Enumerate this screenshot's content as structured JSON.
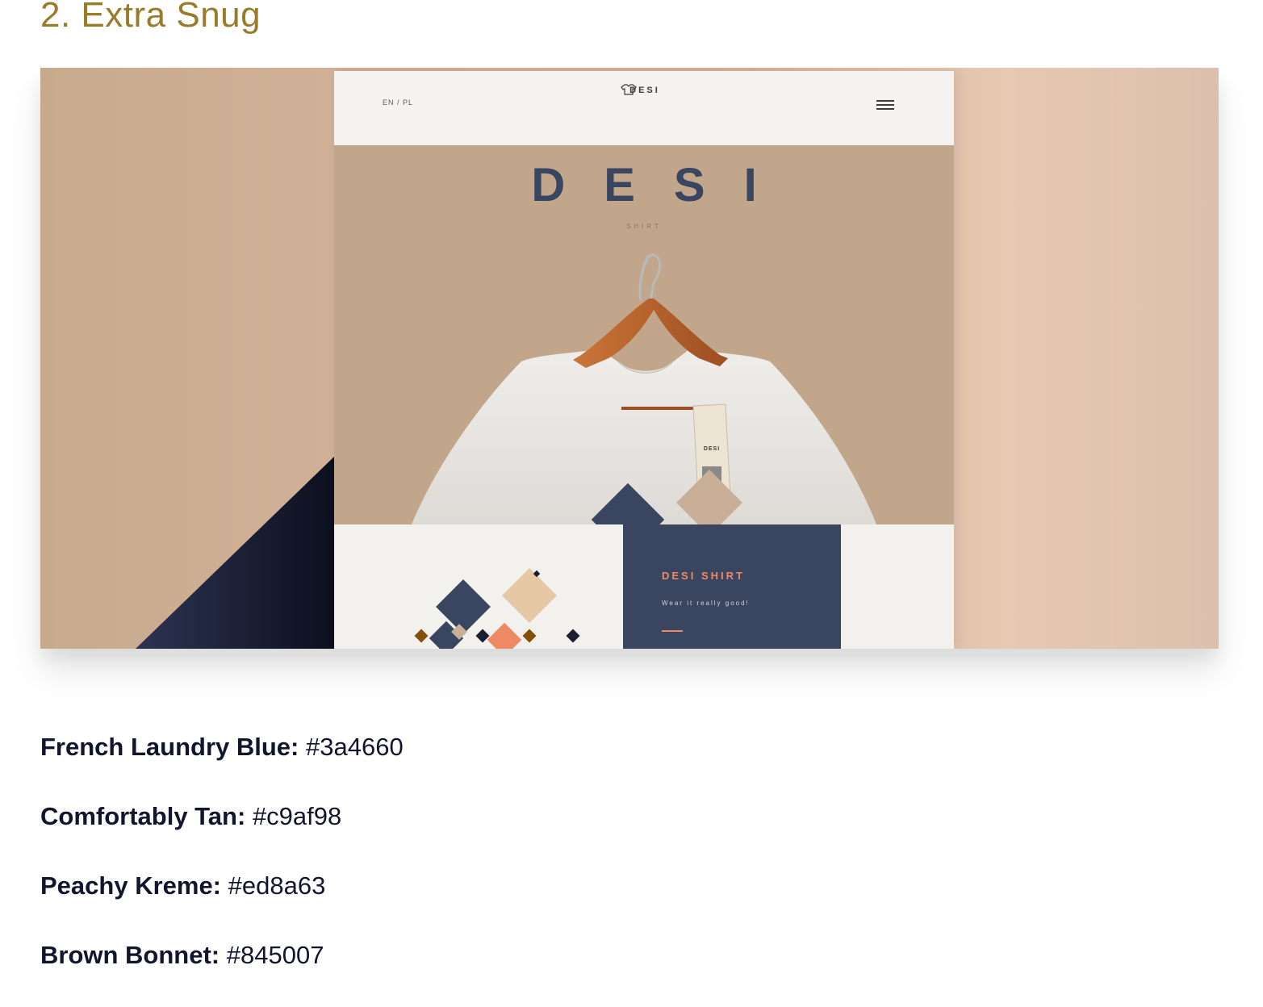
{
  "heading": "2. Extra Snug",
  "mockup": {
    "lang": "EN / PL",
    "logo": "DESI",
    "title": "DESI",
    "subtitle": "SHIRT",
    "tag_logo": "DESI",
    "promo_title": "DESI SHIRT",
    "promo_tagline": "Wear it really good!"
  },
  "palette": [
    {
      "name": "French Laundry Blue:",
      "hex": "#3a4660"
    },
    {
      "name": "Comfortably Tan:",
      "hex": "#c9af98"
    },
    {
      "name": "Peachy Kreme:",
      "hex": "#ed8a63"
    },
    {
      "name": "Brown Bonnet:",
      "hex": "#845007"
    }
  ],
  "colors": {
    "heading": "#9a7b2a",
    "text": "#12152e",
    "navy": "#3a4660",
    "tan": "#c9af98",
    "peach": "#ed8a63",
    "brown": "#845007"
  }
}
